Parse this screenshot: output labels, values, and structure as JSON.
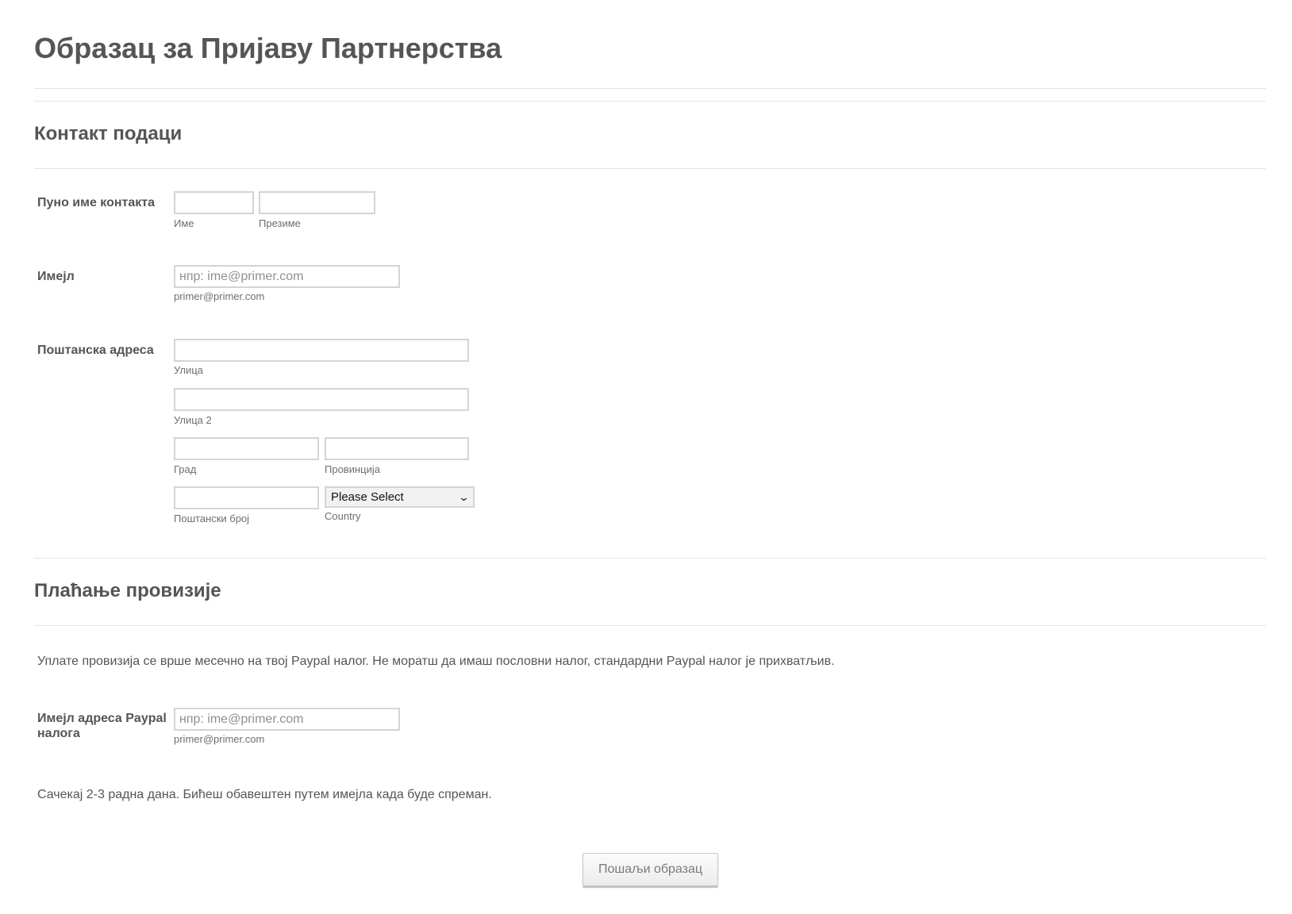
{
  "form": {
    "title": "Образац за Пријаву Партнерства"
  },
  "contact_section": {
    "title": "Контакт подаци",
    "full_name": {
      "label": "Пуно име контакта",
      "first_value": "",
      "first_sublabel": "Име",
      "last_value": "",
      "last_sublabel": "Презиме"
    },
    "email": {
      "label": "Имејл",
      "placeholder": "нпр: ime@primer.com",
      "value": "",
      "sublabel": "primer@primer.com"
    },
    "address": {
      "label": "Поштанска адреса",
      "street_sublabel": "Улица",
      "street2_sublabel": "Улица 2",
      "city_sublabel": "Град",
      "province_sublabel": "Провинција",
      "postal_sublabel": "Поштански број",
      "country_selected": "Please Select",
      "country_sublabel": "Country"
    }
  },
  "payment_section": {
    "title": "Плаћање провизије",
    "info_text": "Уплате провизија се врше месечно на твој Paypal  налог. Не моратш да имаш пословни налог, стандардни Paypal налог је прихватљив.",
    "paypal_email": {
      "label_line1": "Имејл адреса Paypal",
      "label_line2": "налога",
      "placeholder": "нпр: ime@primer.com",
      "value": "",
      "sublabel": "primer@primer.com"
    },
    "wait_text": "Сачекај 2-3 радна дана. Бићеш обавештен путем имејла када буде спреман."
  },
  "submit": {
    "label": "Пошаљи образац"
  }
}
